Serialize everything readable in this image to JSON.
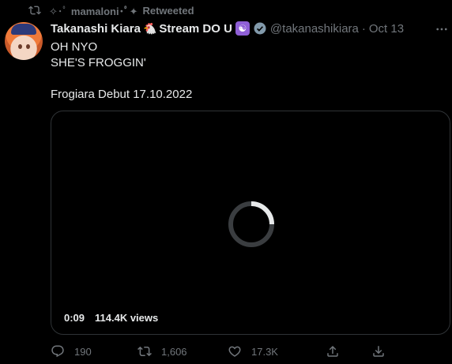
{
  "retweet": {
    "sparkle_left": "✧･ﾟ",
    "name": "mamaloni･ﾟ✦",
    "label": "Retweeted"
  },
  "tweet": {
    "display_name": "Takanashi Kiara",
    "name_suffix": "Stream DO U",
    "handle": "@takanashikiara",
    "dot": "·",
    "date": "Oct 13",
    "lines": [
      "OH NYO",
      "SHE'S FROGGIN'",
      "",
      "Frogiara Debut 17.10.2022"
    ]
  },
  "media": {
    "time": "0:09",
    "views": "114.4K views"
  },
  "actions": {
    "replies": "190",
    "retweets": "1,606",
    "likes": "17.3K"
  },
  "icons": {
    "retweet": "retweet-icon",
    "verified": "verified-badge-icon",
    "more": "more-options-icon",
    "reply": "reply-icon",
    "like": "heart-icon",
    "share": "share-icon",
    "download": "download-icon"
  },
  "colors": {
    "background": "#000000",
    "text_primary": "#e7e9ea",
    "text_secondary": "#71767b",
    "border": "#2f3336"
  }
}
